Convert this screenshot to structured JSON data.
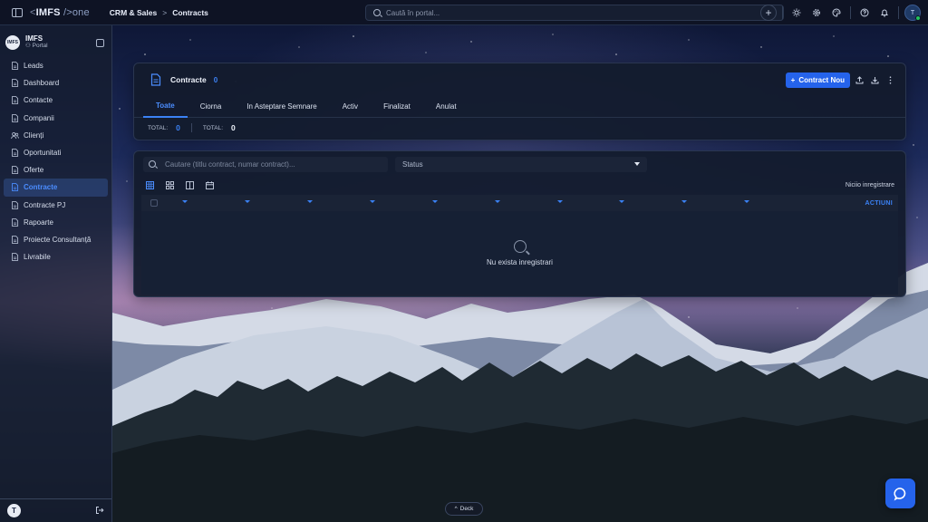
{
  "topbar": {
    "logo_prefix": "<",
    "logo_main": "IMFS",
    "logo_suffix": " />one",
    "breadcrumb": [
      "CRM & Sales",
      "Contracts"
    ],
    "breadcrumb_sep": ">",
    "search_placeholder": "Caută în portal...",
    "avatar_initial": "T",
    "icons": [
      "plus-icon",
      "sun-icon",
      "gear-icon",
      "palette-icon",
      "help-icon",
      "bell-icon"
    ]
  },
  "sidebar": {
    "org_name": "IMFS",
    "org_sub": "Portal",
    "org_logo_text": "IMFS",
    "items": [
      {
        "label": "Leads",
        "icon": "page-icon"
      },
      {
        "label": "Dashboard",
        "icon": "page-icon"
      },
      {
        "label": "Contacte",
        "icon": "page-icon"
      },
      {
        "label": "Companii",
        "icon": "page-icon"
      },
      {
        "label": "Clienți",
        "icon": "users-icon"
      },
      {
        "label": "Oportunitati",
        "icon": "page-icon"
      },
      {
        "label": "Oferte",
        "icon": "page-icon"
      },
      {
        "label": "Contracte",
        "icon": "page-icon",
        "active": true
      },
      {
        "label": "Contracte PJ",
        "icon": "page-icon"
      },
      {
        "label": "Rapoarte",
        "icon": "page-icon"
      },
      {
        "label": "Proiecte Consultanță",
        "icon": "page-icon"
      },
      {
        "label": "Livrabile",
        "icon": "page-icon"
      }
    ],
    "user_initial": "T"
  },
  "contracts": {
    "title": "Contracte",
    "count": "0",
    "new_button": "Contract Nou",
    "tabs": [
      "Toate",
      "Ciorna",
      "In Asteptare Semnare",
      "Activ",
      "Finalizat",
      "Anulat"
    ],
    "active_tab": "Toate",
    "totals": [
      {
        "label": "TOTAL:",
        "value": "0",
        "color": "#3b82f6"
      },
      {
        "label": "TOTAL:",
        "value": "0",
        "color": "#eef2fb"
      }
    ]
  },
  "table": {
    "search_placeholder": "Cautare (titlu contract, numar contract)...",
    "status_placeholder": "Status",
    "no_records": "Niciio inregistrare",
    "actions_header": "ACTIUNI",
    "empty_text": "Nu exista inregistrari",
    "view_icons": [
      "table-view-icon",
      "grid-view-icon",
      "columns-view-icon",
      "calendar-view-icon"
    ]
  },
  "dock_label": "Deck",
  "colors": {
    "accent": "#3b82f6",
    "button": "#2563eb",
    "surface": "#131b2d",
    "online": "#22c55e"
  }
}
